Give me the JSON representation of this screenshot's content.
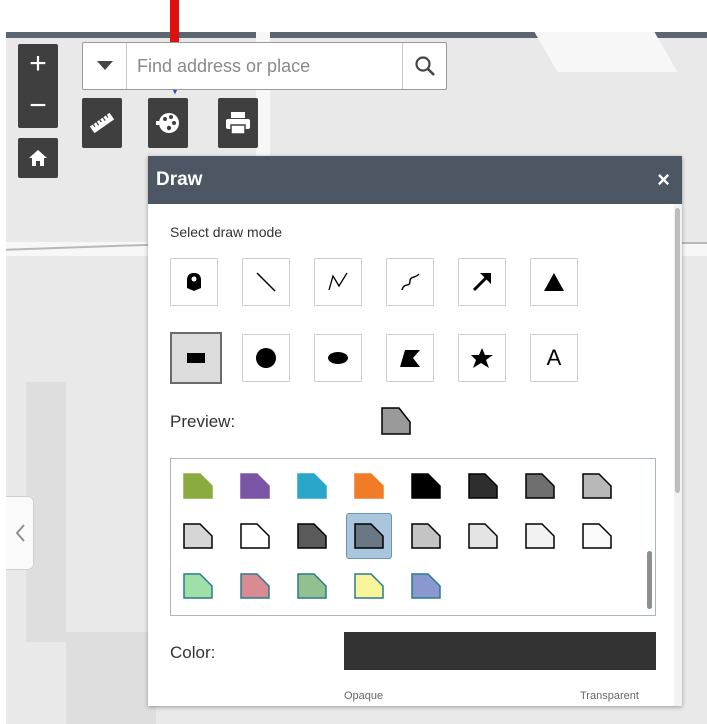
{
  "map": {
    "zoom_in": "+",
    "zoom_out": "−",
    "search_placeholder": "Find address or place"
  },
  "icons": {
    "dropdown": "chevron-down-icon",
    "search": "search-icon",
    "measure": "ruler-icon",
    "draw": "palette-icon",
    "print": "printer-icon",
    "home": "home-icon",
    "side_toggle": "chevron-left-icon"
  },
  "panel": {
    "title": "Draw",
    "close": "×",
    "select_mode_label": "Select draw mode",
    "mode_buttons_row1": [
      "point",
      "line",
      "polyline",
      "freehand-polyline",
      "arrow",
      "triangle"
    ],
    "mode_buttons_row2": [
      "extent",
      "circle",
      "ellipse",
      "polygon",
      "freehand-polygon",
      "text"
    ],
    "text_mode_label": "A",
    "selected_mode": "extent",
    "preview_label": "Preview:",
    "color_label": "Color:",
    "color_value": "#333333",
    "opaque_label": "Opaque",
    "transparent_label": "Transparent"
  },
  "swatches": [
    {
      "fill": "#8aab3f",
      "stroke": "#8aab3f"
    },
    {
      "fill": "#7a55a6",
      "stroke": "#7a55a6"
    },
    {
      "fill": "#2aa6c9",
      "stroke": "#2aa6c9"
    },
    {
      "fill": "#f07c28",
      "stroke": "#f07c28"
    },
    {
      "fill": "#000000",
      "stroke": "#000000"
    },
    {
      "fill": "#2e2e2e",
      "stroke": "#000000"
    },
    {
      "fill": "#6e6e6e",
      "stroke": "#000000"
    },
    {
      "fill": "#b8b8b8",
      "stroke": "#000000"
    },
    {
      "fill": "#d6d6d6",
      "stroke": "#000000"
    },
    {
      "fill": "#ffffff",
      "stroke": "#000000"
    },
    {
      "fill": "#5a5a5a",
      "stroke": "#000000"
    },
    {
      "fill": "#6a7785",
      "stroke": "#000000"
    },
    {
      "fill": "#c4c4c4",
      "stroke": "#000000"
    },
    {
      "fill": "#e4e4e4",
      "stroke": "#000000"
    },
    {
      "fill": "#f2f2f2",
      "stroke": "#000000"
    },
    {
      "fill": "#fafafa",
      "stroke": "#000000"
    },
    {
      "fill": "#9ee0a8",
      "stroke": "#2a7a8c"
    },
    {
      "fill": "#d88b92",
      "stroke": "#2a7a8c"
    },
    {
      "fill": "#92c08e",
      "stroke": "#2a7a8c"
    },
    {
      "fill": "#f8f49a",
      "stroke": "#2a7a8c"
    },
    {
      "fill": "#8a98d0",
      "stroke": "#2a7a8c"
    }
  ],
  "selected_swatch": 11,
  "colors": {
    "panel_header": "#4d5663",
    "toolbar_button": "#3f3f3f",
    "annotation_arrow": "#e01010"
  }
}
